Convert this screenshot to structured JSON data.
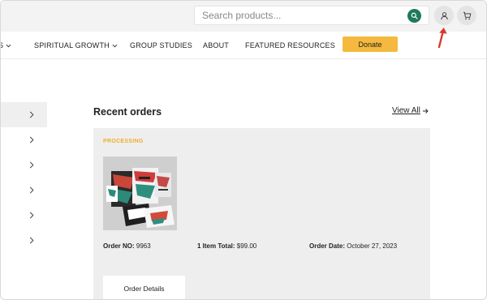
{
  "header": {
    "search_placeholder": "Search products...",
    "icons": {
      "search": "search-icon",
      "account": "user-icon",
      "cart": "cart-icon"
    },
    "colors": {
      "search_button": "#1f7a57",
      "annotation_arrow": "#d63a2c"
    }
  },
  "nav": {
    "items": [
      {
        "label": "S",
        "has_dropdown": true
      },
      {
        "label": "SPIRITUAL GROWTH",
        "has_dropdown": true
      },
      {
        "label": "GROUP STUDIES",
        "has_dropdown": false
      },
      {
        "label": "ABOUT",
        "has_dropdown": false
      },
      {
        "label": "FEATURED RESOURCES",
        "has_dropdown": false
      }
    ],
    "donate_label": "Donate",
    "donate_color": "#f4b93e"
  },
  "sidebar": {
    "rows": [
      {
        "icon": "chevron-right-icon",
        "active": true
      },
      {
        "icon": "chevron-right-icon",
        "active": false
      },
      {
        "icon": "chevron-right-icon",
        "active": false
      },
      {
        "icon": "chevron-right-icon",
        "active": false
      },
      {
        "icon": "chevron-right-icon",
        "active": false
      },
      {
        "icon": "chevron-right-icon",
        "active": false
      }
    ]
  },
  "orders": {
    "title": "Recent orders",
    "view_all_label": "View All",
    "order": {
      "status": "PROCESSING",
      "status_color": "#f0ad2e",
      "order_no_label": "Order NO:",
      "order_no": "9963",
      "items_label": "1 Item Total:",
      "total": "$99.00",
      "date_label": "Order Date:",
      "date": "October 27, 2023",
      "details_button": "Order Details"
    }
  }
}
